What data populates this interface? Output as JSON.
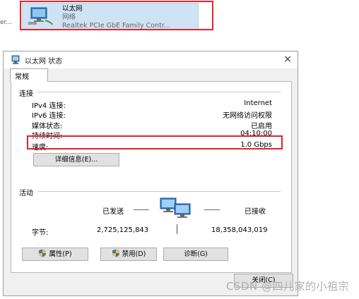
{
  "adapter": {
    "left_cut": "er...",
    "name": "以太网",
    "network": "网络",
    "device": "Realtek PCIe GbE Family Contr..."
  },
  "dialog": {
    "title": "以太网 状态",
    "close_symbol": "×",
    "tab": "常规",
    "connection": {
      "section": "连接",
      "rows": [
        {
          "label": "IPv4 连接:",
          "value": "Internet"
        },
        {
          "label": "IPv6 连接:",
          "value": "无网络访问权限"
        },
        {
          "label": "媒体状态:",
          "value": "已启用"
        },
        {
          "label": "持续时间:",
          "value": "04:10:00"
        },
        {
          "label": "速度:",
          "value": "1.0 Gbps"
        }
      ],
      "details_button": "详细信息(E)..."
    },
    "activity": {
      "section": "活动",
      "sent_label": "已发送",
      "received_label": "已接收",
      "bytes_label": "字节:",
      "sent_bytes": "2,725,125,843",
      "received_bytes": "18,358,043,019"
    },
    "buttons": {
      "properties": "属性(P)",
      "disable": "禁用(D)",
      "diagnose": "诊断(G)",
      "close": "关闭(C)"
    }
  },
  "watermark": "CSDN @四儿家的小祖宗",
  "colors": {
    "highlight": "#e0242d",
    "selection": "#cfe3f5"
  }
}
